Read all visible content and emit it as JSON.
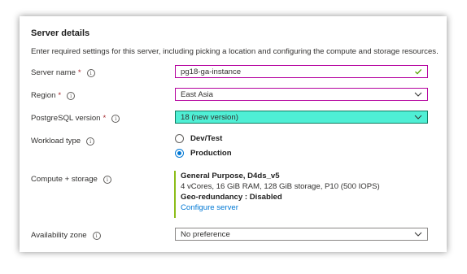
{
  "section": {
    "title": "Server details",
    "description": "Enter required settings for this server, including picking a location and configuring the compute and storage resources."
  },
  "server_name": {
    "label": "Server name",
    "required_mark": "*",
    "value": "pg18-ga-instance"
  },
  "region": {
    "label": "Region",
    "required_mark": "*",
    "value": "East Asia"
  },
  "postgres_version": {
    "label": "PostgreSQL version",
    "required_mark": "*",
    "value": "18 (new version)",
    "highlight_color": "#4fefd5"
  },
  "workload_type": {
    "label": "Workload type",
    "options": [
      {
        "label": "Dev/Test",
        "selected": false
      },
      {
        "label": "Production",
        "selected": true
      }
    ]
  },
  "compute_storage": {
    "label": "Compute + storage",
    "tier": "General Purpose, D4ds_v5",
    "specs": "4 vCores, 16 GiB RAM, 128 GiB storage, P10 (500 IOPS)",
    "geo": "Geo-redundancy : Disabled",
    "configure_link": "Configure server"
  },
  "availability_zone": {
    "label": "Availability zone",
    "value": "No preference"
  },
  "icons": {
    "info": "i",
    "check": "checkmark-icon",
    "chevron": "chevron-down-icon"
  },
  "colors": {
    "accent": "#0078d4",
    "valid_check": "#57a300",
    "compute_bar": "#8cbd18",
    "required": "#a4262c"
  }
}
